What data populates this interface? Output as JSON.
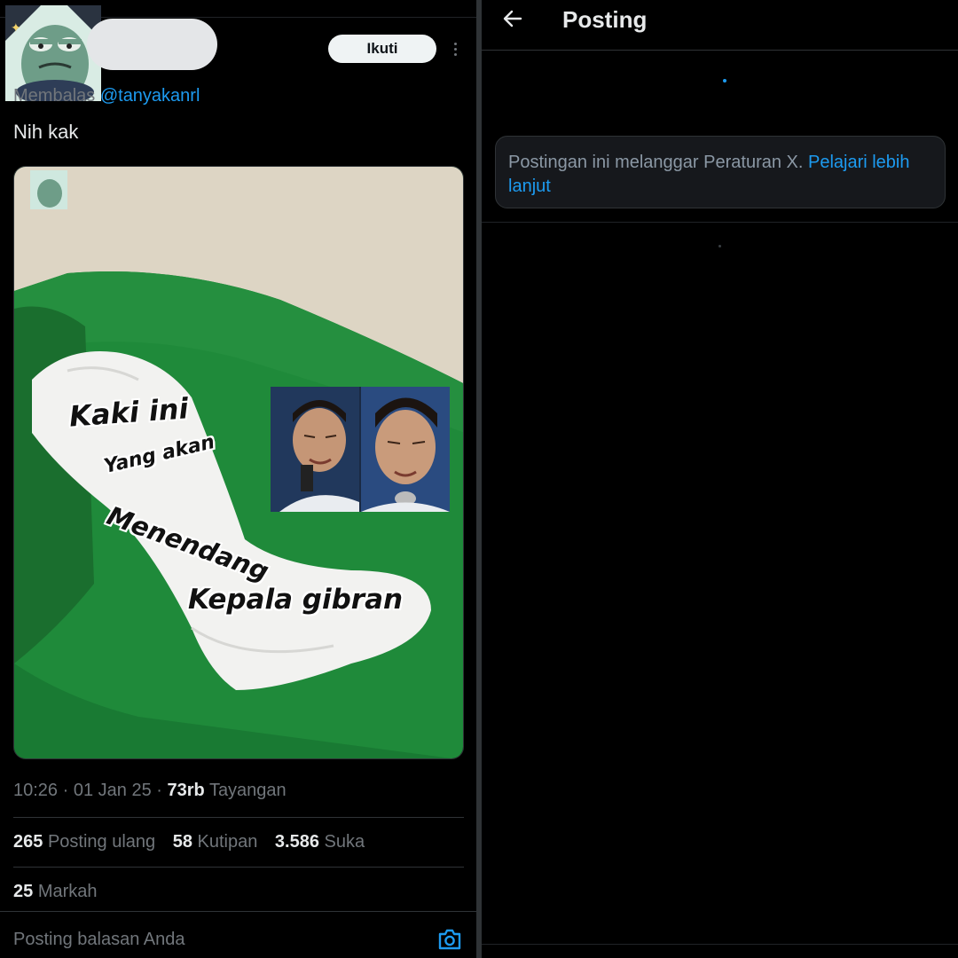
{
  "post": {
    "follow_label": "Ikuti",
    "reply_prefix": "Membalas",
    "reply_mention": "@tanyakanrl",
    "text": "Nih kak",
    "image_captions": [
      "Kaki ini",
      "Yang akan",
      "Menendang",
      "Kepala gibran"
    ],
    "time": "10:26",
    "date": "01 Jan 25",
    "views_count": "73rb",
    "views_label": "Tayangan",
    "reposts_count": "265",
    "reposts_label": "Posting ulang",
    "quotes_count": "58",
    "quotes_label": "Kutipan",
    "likes_count": "3.586",
    "likes_label": "Suka",
    "bookmarks_count": "25",
    "bookmarks_label": "Markah"
  },
  "reply_bar": {
    "placeholder": "Posting balasan Anda",
    "icon": "camera-icon"
  },
  "right_panel": {
    "title": "Posting",
    "back_icon": "arrow-left-icon",
    "notice_text": "Postingan ini melanggar Peraturan X.",
    "notice_link": "Pelajari lebih lanjut"
  },
  "colors": {
    "background": "#000000",
    "text_primary": "#e7e9ea",
    "text_secondary": "#71767b",
    "accent": "#1d9bf0",
    "notice_bg": "#16181c"
  }
}
